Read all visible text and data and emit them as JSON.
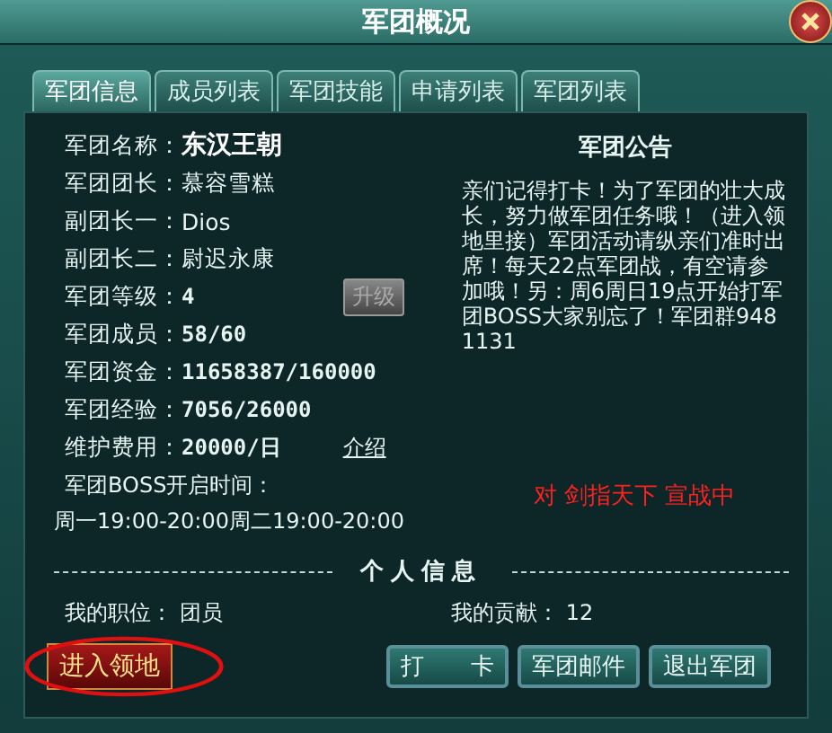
{
  "window": {
    "title": "军团概况"
  },
  "tabs": [
    {
      "label": "军团信息",
      "selected": true
    },
    {
      "label": "成员列表",
      "selected": false
    },
    {
      "label": "军团技能",
      "selected": false
    },
    {
      "label": "申请列表",
      "selected": false
    },
    {
      "label": "军团列表",
      "selected": false
    }
  ],
  "info_rows": [
    {
      "label": "军团名称：",
      "value": "东汉王朝",
      "kind": "title"
    },
    {
      "label": "军团团长：",
      "value": "慕容雪糕",
      "kind": "text"
    },
    {
      "label": "副团长一：",
      "value": "Dios",
      "kind": "text"
    },
    {
      "label": "副团长二：",
      "value": "尉迟永康",
      "kind": "text"
    },
    {
      "label": "军团等级：",
      "value": "4",
      "kind": "number",
      "button": {
        "label": "升级",
        "disabled": true
      }
    },
    {
      "label": "军团成员：",
      "value": "58/60",
      "kind": "number"
    },
    {
      "label": "军团资金：",
      "value": "11658387/160000",
      "kind": "number"
    },
    {
      "label": "军团经验：",
      "value": "7056/26000",
      "kind": "number"
    },
    {
      "label": "维护费用：",
      "value": "20000/日",
      "kind": "number",
      "link": "介绍"
    }
  ],
  "boss": {
    "label": "军团BOSS开启时间：",
    "times": "周一19:00-20:00周二19:00-20:00"
  },
  "notice": {
    "title": "军团公告",
    "text": "亲们记得打卡！为了军团的壮大成长，努力做军团任务哦！（进入领地里接）军团活动请纵亲们准时出席！每天22点军团战，有空请参加哦！另：周6周日19点开始打军团BOSS大家别忘了！军团群9481131"
  },
  "war_status": "对 剑指天下 宣战中",
  "personal": {
    "heading": "个人信息",
    "position_label": "我的职位：",
    "position": "团员",
    "contribution_label": "我的贡献：",
    "contribution": "12"
  },
  "enter_button": {
    "label": "进入领地",
    "annotated": true
  },
  "actions": [
    "打　　卡",
    "军团邮件",
    "退出军团"
  ]
}
